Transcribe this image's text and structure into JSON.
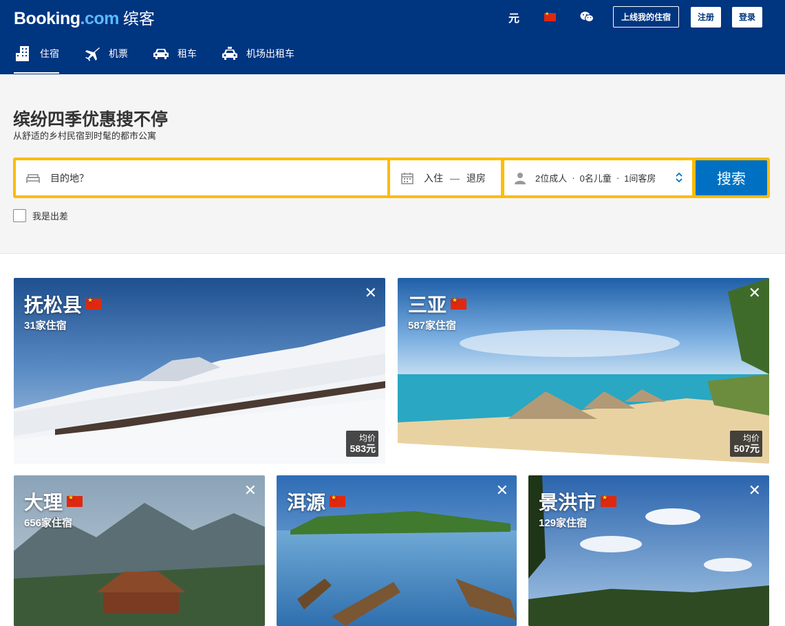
{
  "header": {
    "logo_brand": "Booking",
    "logo_domain": ".com",
    "logo_cn": "缤客",
    "currency": "元",
    "list_property": "上线我的住宿",
    "register": "注册",
    "login": "登录",
    "flag_icon": "china-flag",
    "colors": {
      "header_bg": "#003580",
      "accent": "#febb02",
      "button": "#0071c2"
    }
  },
  "nav": [
    {
      "label": "住宿",
      "icon": "hotel-icon",
      "active": true
    },
    {
      "label": "机票",
      "icon": "plane-icon"
    },
    {
      "label": "租车",
      "icon": "car-icon"
    },
    {
      "label": "机场出租车",
      "icon": "taxi-icon"
    }
  ],
  "hero": {
    "title": "缤纷四季优惠搜不停",
    "subtitle": "从舒适的乡村民宿到时髦的都市公寓"
  },
  "search": {
    "destination_placeholder": "目的地？",
    "checkin": "入住",
    "dash": "—",
    "checkout": "退房",
    "adults": "2位成人",
    "children": "0名儿童",
    "rooms": "1间客房",
    "separator": "·",
    "button": "搜索",
    "business_trip": "我是出差"
  },
  "cards": [
    {
      "name": "抚松县",
      "count": "31家住宿",
      "price_label": "均价",
      "price": "583元"
    },
    {
      "name": "三亚",
      "count": "587家住宿",
      "price_label": "均价",
      "price": "507元"
    },
    {
      "name": "大理",
      "count": "656家住宿"
    },
    {
      "name": "洱源",
      "count": ""
    },
    {
      "name": "景洪市",
      "count": "129家住宿"
    }
  ],
  "close_symbol": "✕"
}
